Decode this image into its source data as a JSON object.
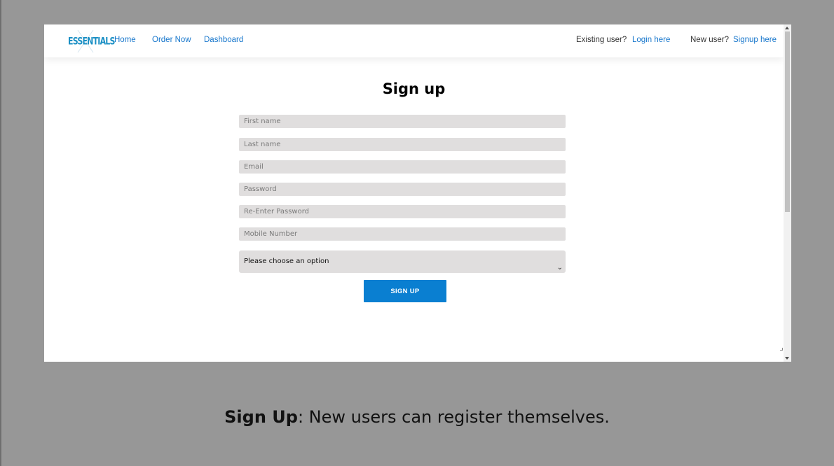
{
  "navbar": {
    "logo_text": "ESSENTIALS",
    "links": [
      "Home",
      "Order Now",
      "Dashboard"
    ],
    "existing_user_label": "Existing user?",
    "login_link": "Login here",
    "new_user_label": "New user?",
    "signup_link": "Signup here"
  },
  "form": {
    "title": "Sign up",
    "fields": {
      "first_name": "First name",
      "last_name": "Last name",
      "email": "Email",
      "password": "Password",
      "re_password": "Re-Enter Password",
      "mobile": "Mobile Number"
    },
    "select_value": "Please choose an option",
    "submit_label": "SIGN UP"
  },
  "caption": {
    "bold": "Sign Up",
    "rest": ": New users can register themselves."
  },
  "colors": {
    "background": "#979797",
    "link": "#1877cc",
    "button": "#0a7fd1",
    "field": "#e0dede"
  }
}
